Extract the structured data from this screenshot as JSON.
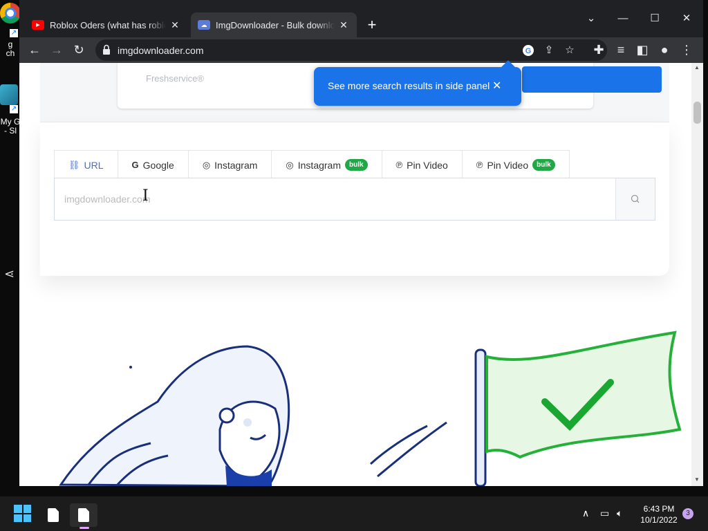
{
  "desktop": {
    "icons": [
      {
        "label": "g",
        "label2": "ch"
      },
      {
        "label": "My G",
        "label2": "- Sl"
      }
    ]
  },
  "browser": {
    "tabs": [
      {
        "title": "Roblox Oders (what has roblox b",
        "favicon": "youtube-icon"
      },
      {
        "title": "ImgDownloader - Bulk downloade",
        "favicon": "imgdownloader-icon"
      }
    ],
    "new_tab_glyph": "+",
    "url": "imgdownloader.com"
  },
  "page": {
    "freshservice": "Freshservice®",
    "search_tabs": [
      {
        "label": "URL",
        "icon": "link-icon",
        "active": true
      },
      {
        "label": "Google",
        "icon": "google-icon"
      },
      {
        "label": "Instagram",
        "icon": "instagram-icon"
      },
      {
        "label": "Instagram",
        "icon": "instagram-icon",
        "badge": "bulk"
      },
      {
        "label": "Pin Video",
        "icon": "pinterest-icon"
      },
      {
        "label": "Pin Video",
        "icon": "pinterest-icon",
        "badge": "bulk"
      }
    ],
    "search_placeholder": "imgdownloader.com"
  },
  "toast": {
    "text": "See more search results in side panel",
    "close": "✕"
  },
  "taskbar": {
    "time": "6:43 PM",
    "date": "10/1/2022",
    "notifications": "3"
  },
  "colors": {
    "accent": "#1a73e8",
    "bulk_badge": "#1fa845",
    "active_tab_text": "#3d6fd8"
  }
}
